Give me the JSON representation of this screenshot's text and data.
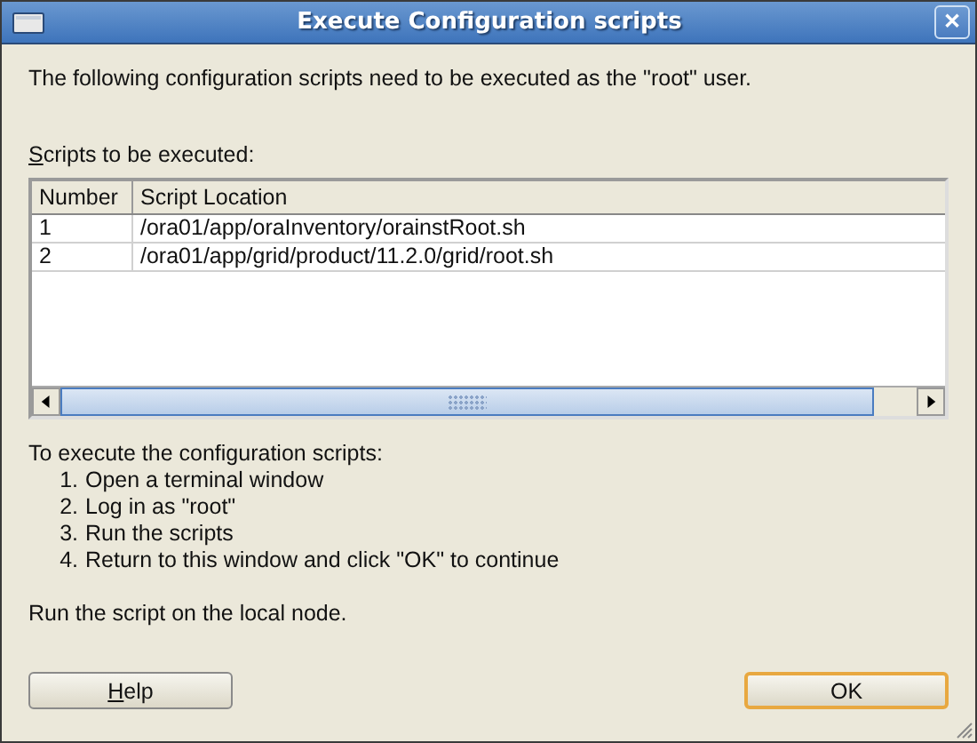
{
  "window": {
    "title": "Execute Configuration scripts",
    "close_glyph": "✕"
  },
  "intro": "The following configuration scripts need to be executed as the \"root\" user.",
  "table_label": {
    "mnemonic": "S",
    "rest": "cripts to be executed:"
  },
  "table": {
    "columns": [
      "Number",
      "Script Location"
    ],
    "rows": [
      {
        "cells": [
          "1",
          "/ora01/app/oraInventory/orainstRoot.sh"
        ],
        "selected": false
      },
      {
        "cells": [
          "2",
          "/ora01/app/grid/product/11.2.0/grid/root.sh"
        ],
        "selected": false
      }
    ]
  },
  "instructions": {
    "heading": "To execute the configuration scripts:",
    "steps": [
      {
        "number": "1.",
        "text": "Open a terminal window"
      },
      {
        "number": "2.",
        "text": "Log in as \"root\""
      },
      {
        "number": "3.",
        "text": "Run the scripts"
      },
      {
        "number": "4.",
        "text": "Return to this window and click \"OK\" to continue"
      }
    ]
  },
  "note": "Run the script on the local node.",
  "buttons": [
    {
      "mnemonic": "H",
      "rest": "elp",
      "default": false
    },
    {
      "rest": "OK",
      "default": true
    }
  ]
}
